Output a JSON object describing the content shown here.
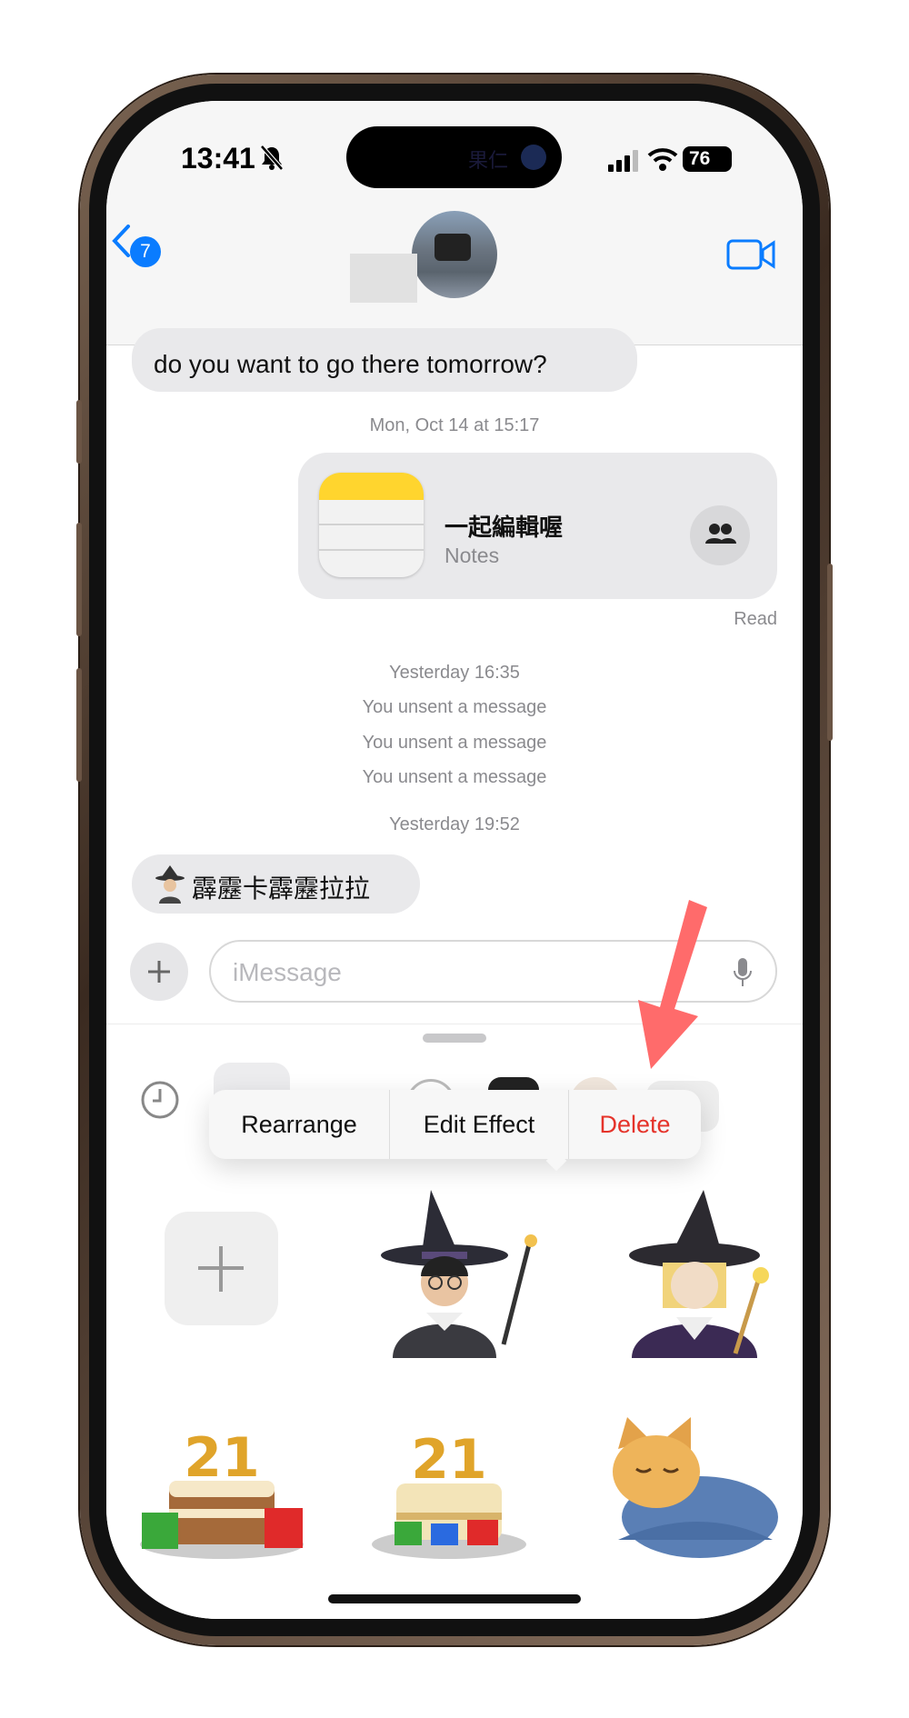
{
  "status_bar": {
    "time": "13:41",
    "battery": "76",
    "island_text": "果仁"
  },
  "header": {
    "back_badge": "7"
  },
  "messages": {
    "incoming_1": "do you want to go there tomorrow?",
    "timestamp_1": "Mon, Oct 14 at 15:17",
    "notes_card": {
      "title": "一起編輯喔",
      "subtitle": "Notes"
    },
    "read_receipt": "Read",
    "timestamp_2": "Yesterday 16:35",
    "unsent": [
      "You unsent a message",
      "You unsent a message",
      "You unsent a message"
    ],
    "timestamp_3": "Yesterday 19:52",
    "incoming_2": "霹靂卡霹靂拉拉"
  },
  "composer": {
    "placeholder": "iMessage"
  },
  "context_menu": {
    "rearrange": "Rearrange",
    "edit_effect": "Edit Effect",
    "delete": "Delete"
  },
  "colors": {
    "accent": "#0a7cff",
    "delete": "#e5332a",
    "arrow": "#ff6b6b"
  }
}
